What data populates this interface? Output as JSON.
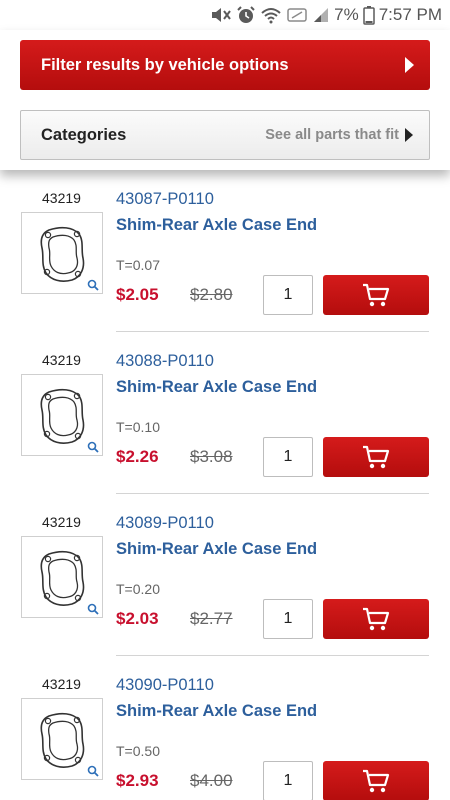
{
  "status_bar": {
    "battery_percent": "7%",
    "time": "7:57 PM",
    "icons": [
      "mute-icon",
      "alarm-icon",
      "wifi-icon",
      "nfc-icon",
      "signal-icon",
      "battery-icon"
    ]
  },
  "filter": {
    "label": "Filter results by vehicle options"
  },
  "categories": {
    "label": "Categories",
    "see_all": "See all parts that fit"
  },
  "colors": {
    "accent_red": "#c8102e",
    "link_blue": "#2d5f9c"
  },
  "products": [
    {
      "ref": "43219",
      "part_number": "43087-P0110",
      "name": "Shim-Rear Axle Case End",
      "spec": "T=0.07",
      "price": "$2.05",
      "old_price": "$2.80",
      "qty": "1"
    },
    {
      "ref": "43219",
      "part_number": "43088-P0110",
      "name": "Shim-Rear Axle Case End",
      "spec": "T=0.10",
      "price": "$2.26",
      "old_price": "$3.08",
      "qty": "1"
    },
    {
      "ref": "43219",
      "part_number": "43089-P0110",
      "name": "Shim-Rear Axle Case End",
      "spec": "T=0.20",
      "price": "$2.03",
      "old_price": "$2.77",
      "qty": "1"
    },
    {
      "ref": "43219",
      "part_number": "43090-P0110",
      "name": "Shim-Rear Axle Case End",
      "spec": "T=0.50",
      "price": "$2.93",
      "old_price": "$4.00",
      "qty": "1"
    }
  ]
}
